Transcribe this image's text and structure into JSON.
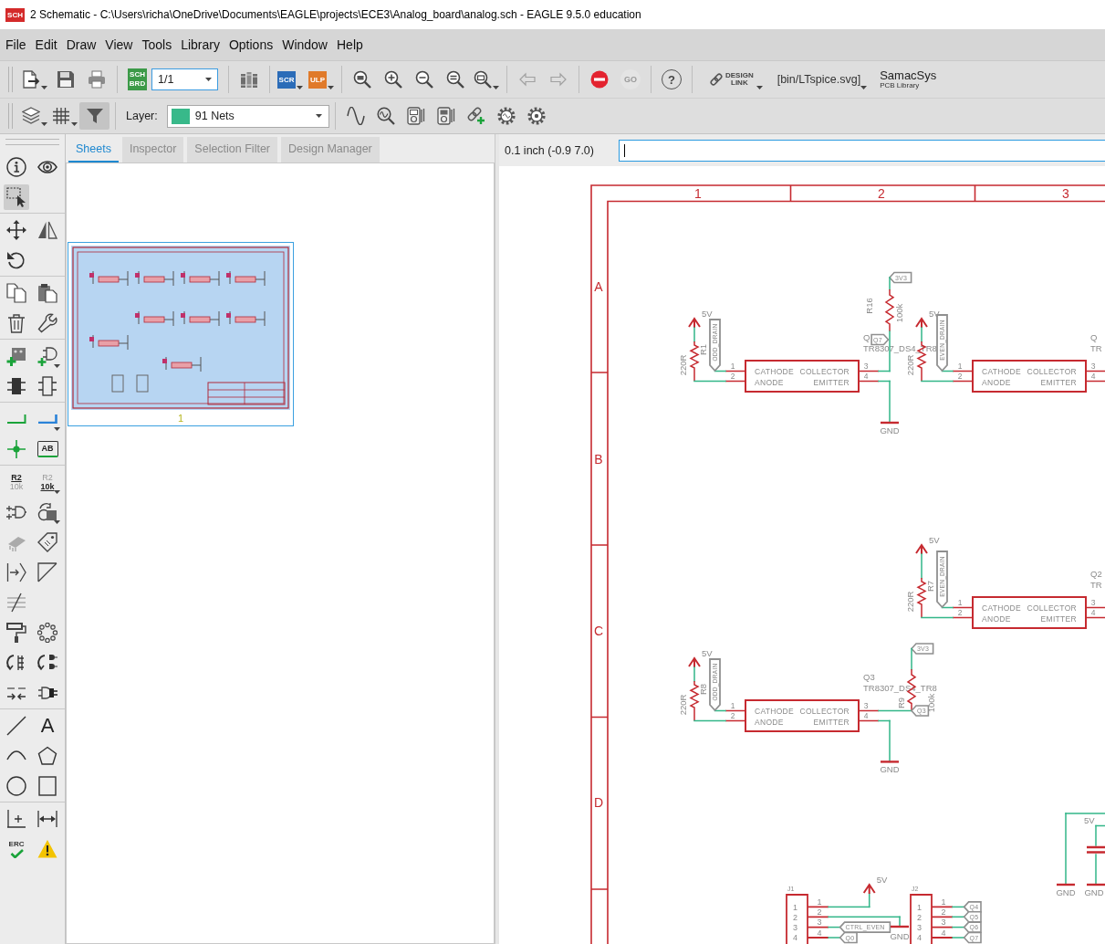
{
  "window": {
    "app_icon": "SCH",
    "title": "2 Schematic - C:\\Users\\richa\\OneDrive\\Documents\\EAGLE\\projects\\ECE3\\Analog_board\\analog.sch - EAGLE 9.5.0 education"
  },
  "menu": [
    "File",
    "Edit",
    "Draw",
    "View",
    "Tools",
    "Library",
    "Options",
    "Window",
    "Help"
  ],
  "toolbar": [
    [
      {
        "kind": "new",
        "dropdown": true,
        "disabled": false
      },
      {
        "kind": "save",
        "disabled": false
      },
      {
        "kind": "print",
        "disabled": false
      }
    ],
    [
      {
        "kind": "sch-brd",
        "lines": [
          "SCH",
          "BRD"
        ],
        "disabled": false
      },
      {
        "kind": "sheet-select",
        "value": "1/1",
        "disabled": false
      }
    ],
    [
      {
        "kind": "library",
        "disabled": false
      }
    ],
    [
      {
        "kind": "script",
        "label": "SCR",
        "dropdown": true,
        "disabled": false
      },
      {
        "kind": "ulp",
        "label": "ULP",
        "dropdown": true,
        "disabled": false
      }
    ],
    [
      {
        "kind": "zoom-fit",
        "disabled": false
      },
      {
        "kind": "zoom-in",
        "disabled": false
      },
      {
        "kind": "zoom-out",
        "disabled": false
      },
      {
        "kind": "zoom-redraw",
        "disabled": false
      },
      {
        "kind": "zoom-select",
        "dropdown": true,
        "disabled": false
      }
    ],
    [
      {
        "kind": "undo",
        "disabled": true
      },
      {
        "kind": "redo",
        "disabled": true
      }
    ],
    [
      {
        "kind": "stop",
        "disabled": false
      },
      {
        "kind": "go",
        "label": "GO",
        "disabled": true
      }
    ],
    [
      {
        "kind": "help",
        "label": "?",
        "disabled": false
      }
    ],
    [
      {
        "kind": "design-link",
        "lines": [
          "DESIGN",
          "LINK"
        ],
        "dropdown": true,
        "disabled": false
      },
      {
        "kind": "text-menu",
        "label": "[bin/LTspice.svg]",
        "dropdown": true,
        "disabled": false
      },
      {
        "kind": "library-service",
        "lines": [
          "SamacSys",
          "PCB Library"
        ],
        "disabled": false
      }
    ]
  ],
  "layer_toolbar": {
    "tools": [
      {
        "kind": "layers",
        "dropdown": true,
        "selected": false
      },
      {
        "kind": "grid",
        "dropdown": true,
        "selected": false
      },
      {
        "kind": "filter",
        "selected": true
      }
    ],
    "layer": {
      "label": "Layer:",
      "value": "91 Nets"
    },
    "sim_tools": [
      {
        "kind": "sine",
        "selected": false
      },
      {
        "kind": "probe",
        "selected": false
      },
      {
        "kind": "meter",
        "selected": false
      },
      {
        "kind": "meter-alt",
        "selected": false
      },
      {
        "kind": "link-add",
        "selected": false
      },
      {
        "kind": "gear",
        "selected": false
      },
      {
        "kind": "gear-alt",
        "selected": false
      }
    ]
  },
  "left_toolbar": [
    [
      [
        {
          "kind": "info",
          "selected": false
        },
        {
          "kind": "show",
          "selected": false
        }
      ],
      [
        {
          "kind": "select",
          "selected": true
        }
      ]
    ],
    [
      [
        {
          "kind": "move",
          "selected": false
        },
        {
          "kind": "mirror",
          "selected": false
        }
      ],
      [
        {
          "kind": "rotate",
          "selected": false
        }
      ]
    ],
    [
      [
        {
          "kind": "copy",
          "selected": false
        },
        {
          "kind": "paste",
          "selected": false
        }
      ],
      [
        {
          "kind": "delete",
          "selected": false
        },
        {
          "kind": "change",
          "selected": false
        }
      ]
    ],
    [
      [
        {
          "kind": "add",
          "selected": false
        },
        {
          "kind": "invoke",
          "dropdown": true,
          "selected": false
        }
      ],
      [
        {
          "kind": "replace",
          "selected": false
        },
        {
          "kind": "edit",
          "selected": false
        }
      ]
    ],
    [
      [
        {
          "kind": "net",
          "selected": false
        },
        {
          "kind": "bus",
          "dropdown": true,
          "selected": false
        }
      ],
      [
        {
          "kind": "junction",
          "selected": false
        },
        {
          "kind": "label",
          "label": "AB",
          "selected": false
        }
      ]
    ],
    [
      [
        {
          "kind": "name",
          "top": "R2",
          "bottom": "10k",
          "selected": false
        },
        {
          "kind": "value",
          "top": "R2",
          "bottom": "10k",
          "dropdown": true,
          "selected": false
        }
      ],
      [
        {
          "kind": "gate",
          "selected": false
        },
        {
          "kind": "smash",
          "dropdown": true,
          "selected": false
        }
      ],
      [
        {
          "kind": "package",
          "selected": false
        },
        {
          "kind": "attribute",
          "selected": false
        }
      ],
      [
        {
          "kind": "pin",
          "selected": false
        },
        {
          "kind": "miter",
          "selected": false
        }
      ],
      [
        {
          "kind": "split",
          "selected": false
        }
      ],
      [
        {
          "kind": "paint",
          "selected": false
        },
        {
          "kind": "ripup",
          "selected": false
        }
      ],
      [
        {
          "kind": "swappin",
          "selected": false
        },
        {
          "kind": "swapgate",
          "selected": false
        }
      ],
      [
        {
          "kind": "netbreak",
          "selected": false
        },
        {
          "kind": "connect",
          "selected": false
        }
      ]
    ],
    [
      [
        {
          "kind": "line",
          "selected": false
        },
        {
          "kind": "text",
          "label": "A",
          "selected": false
        }
      ],
      [
        {
          "kind": "arc",
          "selected": false
        },
        {
          "kind": "polygon",
          "selected": false
        }
      ],
      [
        {
          "kind": "circle",
          "selected": false
        },
        {
          "kind": "rect",
          "selected": false
        }
      ]
    ],
    [
      [
        {
          "kind": "dimension",
          "selected": false
        },
        {
          "kind": "measure",
          "selected": false
        }
      ],
      [
        {
          "kind": "erc",
          "label": "ERC",
          "selected": false
        },
        {
          "kind": "errors",
          "selected": false
        }
      ]
    ]
  ],
  "panel": {
    "tabs": [
      {
        "label": "Sheets",
        "selected": true
      },
      {
        "label": "Inspector",
        "selected": false
      },
      {
        "label": "Selection Filter",
        "selected": false
      },
      {
        "label": "Design Manager",
        "selected": false
      }
    ],
    "sheets": [
      {
        "number": "1",
        "selected": true
      }
    ]
  },
  "command_bar": {
    "readout": "0.1 inch (-0.9 7.0)"
  },
  "schematic": {
    "frame": {
      "columns": [
        "1",
        "2",
        "3"
      ],
      "rows": [
        "A",
        "B",
        "C",
        "D"
      ]
    },
    "optocouplers": [
      {
        "part_name": "Q",
        "part_value": "TR8307_DS4_TR8",
        "supply": "5V",
        "resistor_value": "220R",
        "resistor_name": "R1",
        "drain_flag": "ODD_DRAIN",
        "pins": [
          "1",
          "2",
          "3",
          "4"
        ],
        "pin_labels": [
          "CATHODE",
          "COLLECTOR",
          "ANODE",
          "EMITTER"
        ]
      },
      {
        "part_name": "Q",
        "part_value": "TR",
        "supply": "5V",
        "resistor_value": "220R",
        "drain_flag": "EVEN_DRAIN",
        "pins": [
          "1",
          "2",
          "3",
          "4"
        ],
        "pin_labels": [
          "CATHODE",
          "COLLECTOR",
          "ANODE",
          "EMITTER"
        ]
      },
      {
        "part_name": "Q2",
        "part_value": "TR",
        "supply": "5V",
        "resistor_value": "220R",
        "resistor_name": "R7",
        "drain_flag": "EVEN_DRAIN",
        "pins": [
          "1",
          "2",
          "3",
          "4"
        ],
        "pin_labels": [
          "CATHODE",
          "COLLECTOR",
          "ANODE",
          "EMITTER"
        ]
      },
      {
        "part_name": "Q3",
        "part_value": "TR8307_DS4_TR8",
        "supply": "5V",
        "resistor_value": "220R",
        "resistor_name": "R8",
        "drain_flag": "ODD_DRAIN",
        "pins": [
          "1",
          "2",
          "3",
          "4"
        ],
        "pin_labels": [
          "CATHODE",
          "COLLECTOR",
          "ANODE",
          "EMITTER"
        ]
      }
    ],
    "pullups": [
      {
        "name": "R16",
        "value": "100k",
        "rail": "3V3",
        "output": "Q7"
      },
      {
        "name": "R9",
        "value": "100k",
        "rail": "3V3",
        "output": "Q3"
      }
    ],
    "grounds": [
      "GND",
      "GND",
      "GND",
      "GND",
      "GND"
    ],
    "headers": [
      {
        "name": "J1",
        "box_pins": [
          "1",
          "2",
          "3",
          "4"
        ],
        "pins": [
          "1",
          "2",
          "3",
          "4"
        ],
        "supply": "5V",
        "flags": [
          "CTRL_EVEN",
          "Q0"
        ]
      },
      {
        "name": "J2",
        "box_pins": [
          "1",
          "2",
          "3",
          "4"
        ],
        "pins": [
          "1",
          "2",
          "3",
          "4"
        ],
        "flags": [
          "Q4",
          "Q5",
          "Q6",
          "Q7"
        ]
      }
    ],
    "decoupling": {
      "supply": "5V"
    }
  }
}
